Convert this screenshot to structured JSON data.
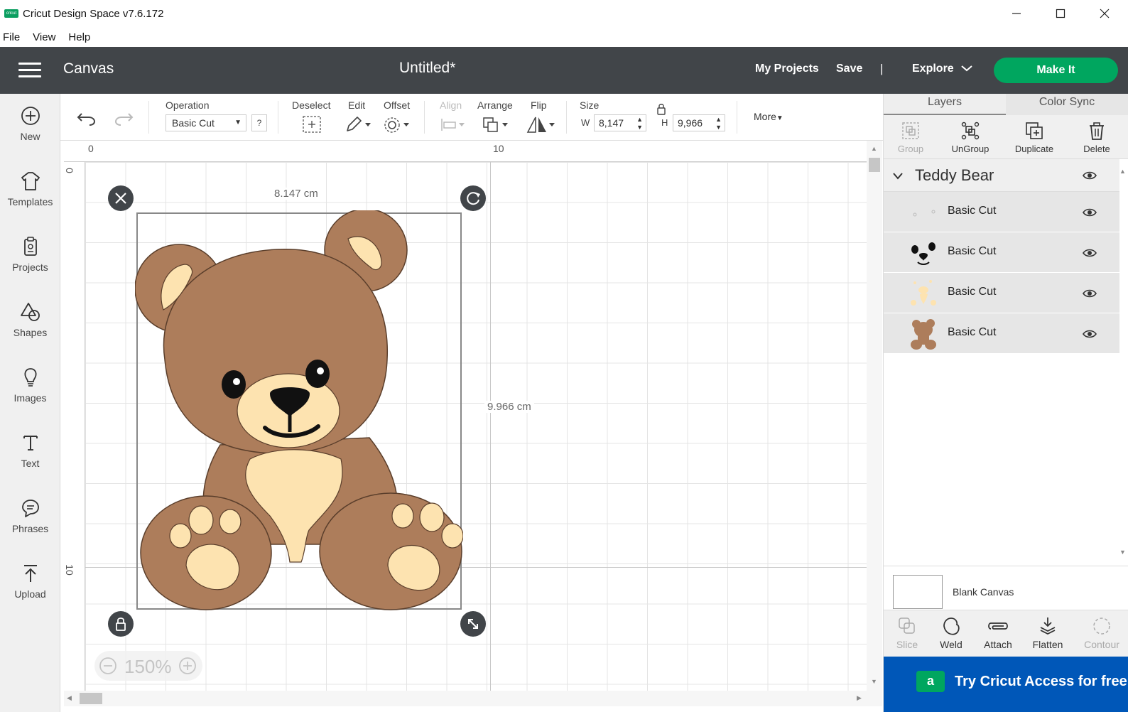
{
  "window": {
    "title": "Cricut Design Space  v7.6.172",
    "logo_text": "cricut"
  },
  "menu": [
    "File",
    "View",
    "Help"
  ],
  "header": {
    "section": "Canvas",
    "project_title": "Untitled*",
    "my_projects": "My Projects",
    "save": "Save",
    "separator": "|",
    "explore": "Explore",
    "make_it": "Make It"
  },
  "sidebar": [
    {
      "label": "New",
      "icon": "plus-circle-icon"
    },
    {
      "label": "Templates",
      "icon": "shirt-icon"
    },
    {
      "label": "Projects",
      "icon": "clipboard-icon"
    },
    {
      "label": "Shapes",
      "icon": "shapes-icon"
    },
    {
      "label": "Images",
      "icon": "lightbulb-icon"
    },
    {
      "label": "Text",
      "icon": "text-icon"
    },
    {
      "label": "Phrases",
      "icon": "speech-bubble-icon"
    },
    {
      "label": "Upload",
      "icon": "upload-icon"
    }
  ],
  "toolbar": {
    "operation_label": "Operation",
    "operation_value": "Basic Cut",
    "help": "?",
    "deselect": "Deselect",
    "edit": "Edit",
    "offset": "Offset",
    "align": "Align",
    "arrange": "Arrange",
    "flip": "Flip",
    "size": "Size",
    "w_label": "W",
    "w_value": "8,147",
    "h_label": "H",
    "h_value": "9,966",
    "more": "More"
  },
  "canvas": {
    "ruler_top": [
      "0",
      "10"
    ],
    "ruler_left": [
      "0",
      "10"
    ],
    "width_dim": "8.147 cm",
    "height_dim": "9.966 cm",
    "zoom": "150%",
    "colors": {
      "bear_brown": "#ad7d5b",
      "bear_cream": "#fde3b0",
      "ink": "#111111"
    }
  },
  "panel": {
    "tabs": [
      "Layers",
      "Color Sync"
    ],
    "actions": [
      {
        "label": "Group",
        "enabled": false
      },
      {
        "label": "UnGroup",
        "enabled": true
      },
      {
        "label": "Duplicate",
        "enabled": true
      },
      {
        "label": "Delete",
        "enabled": true
      }
    ],
    "group_name": "Teddy Bear",
    "layers": [
      {
        "name": "Basic Cut",
        "thumb": "eyes-highlight"
      },
      {
        "name": "Basic Cut",
        "thumb": "face-black"
      },
      {
        "name": "Basic Cut",
        "thumb": "cream-parts"
      },
      {
        "name": "Basic Cut",
        "thumb": "bear-body"
      }
    ],
    "blank_canvas": "Blank Canvas",
    "bottom_actions": [
      {
        "label": "Slice",
        "enabled": false
      },
      {
        "label": "Weld",
        "enabled": true
      },
      {
        "label": "Attach",
        "enabled": true
      },
      {
        "label": "Flatten",
        "enabled": true
      },
      {
        "label": "Contour",
        "enabled": false
      }
    ],
    "access_banner": "Try Cricut Access for free",
    "access_logo": "a"
  }
}
